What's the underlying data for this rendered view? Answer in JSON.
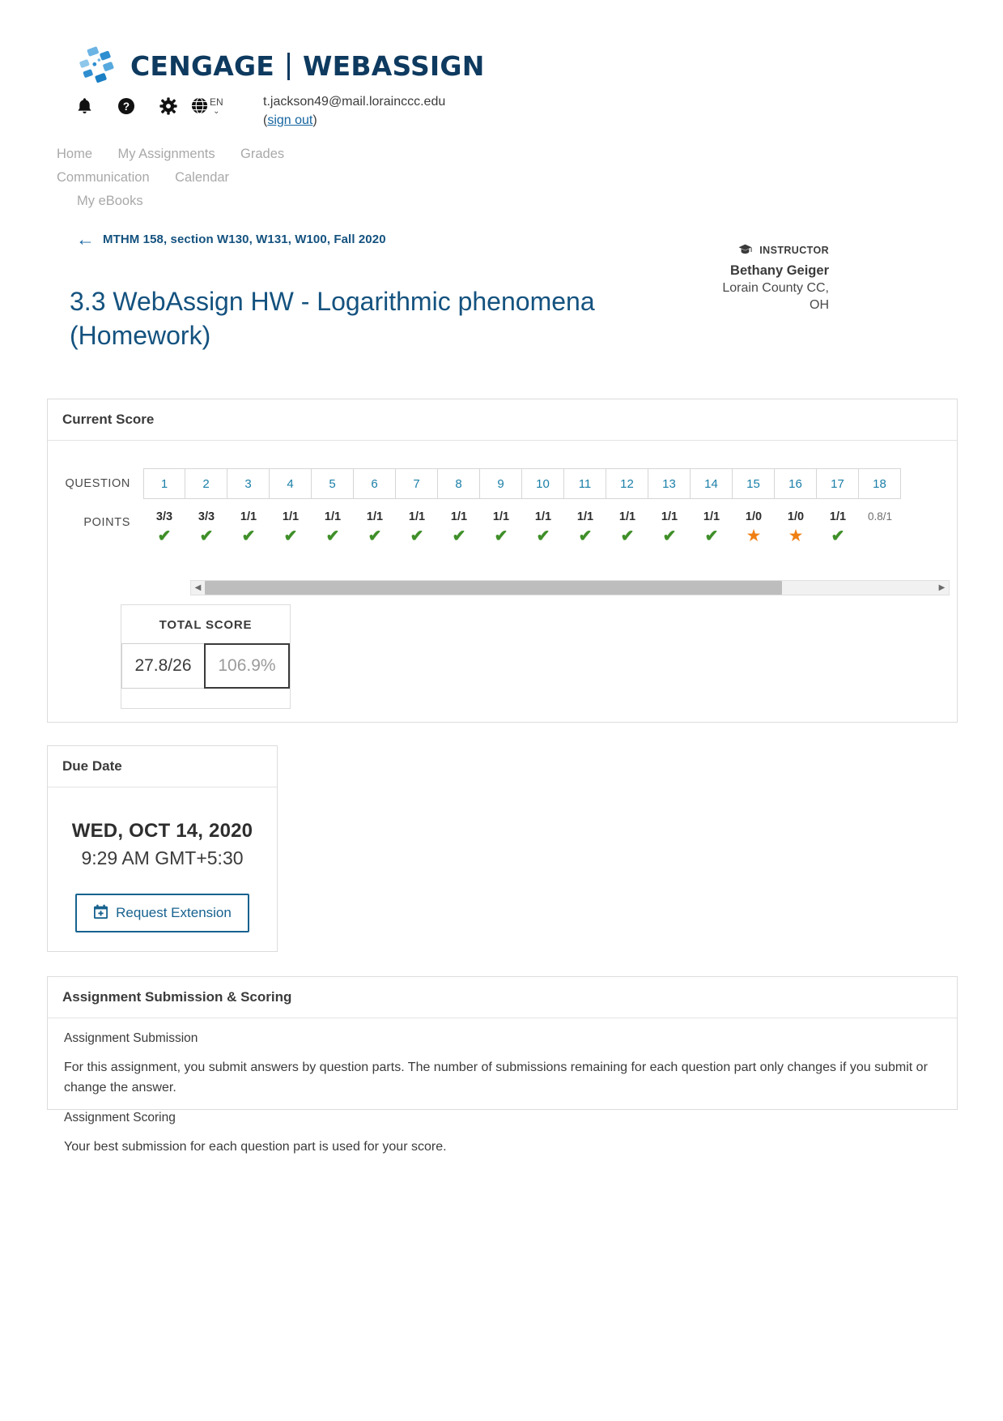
{
  "brand": {
    "primary": "CENGAGE",
    "secondary": "WEBASSIGN",
    "color": "#0e3a5f"
  },
  "utility": {
    "icons": [
      {
        "name": "notifications-icon",
        "glyph": "🔔"
      },
      {
        "name": "help-icon",
        "glyph": "?"
      },
      {
        "name": "settings-icon",
        "glyph": "⚙"
      },
      {
        "name": "language-globe-icon",
        "glyph": "🌐"
      }
    ],
    "language_code": "EN",
    "caret": "⌄"
  },
  "account": {
    "email": "t.jackson49@mail.lorainccc.edu",
    "signout_open": "(",
    "signout_label": "sign out",
    "signout_close": ")"
  },
  "nav": {
    "row1": [
      "Home",
      "My Assignments",
      "Grades"
    ],
    "row2": [
      "Communication",
      "Calendar"
    ],
    "row3": [
      "My eBooks"
    ]
  },
  "breadcrumb": {
    "arrow": "←",
    "label": "MTHM 158, section W130, W131, W100, Fall 2020"
  },
  "title": "3.3 WebAssign HW - Logarithmic phenomena (Homework)",
  "instructor": {
    "cap_icon": "🎓",
    "heading": "INSTRUCTOR",
    "name": "Bethany Geiger",
    "school_line1": "Lorain County CC,",
    "school_line2": "OH"
  },
  "current_score": {
    "card_title": "Current Score",
    "question_label": "QUESTION",
    "points_label": "POINTS",
    "questions": [
      {
        "number": "1",
        "points": "3/3",
        "status": "check"
      },
      {
        "number": "2",
        "points": "3/3",
        "status": "check"
      },
      {
        "number": "3",
        "points": "1/1",
        "status": "check"
      },
      {
        "number": "4",
        "points": "1/1",
        "status": "check"
      },
      {
        "number": "5",
        "points": "1/1",
        "status": "check"
      },
      {
        "number": "6",
        "points": "1/1",
        "status": "check"
      },
      {
        "number": "7",
        "points": "1/1",
        "status": "check"
      },
      {
        "number": "8",
        "points": "1/1",
        "status": "check"
      },
      {
        "number": "9",
        "points": "1/1",
        "status": "check"
      },
      {
        "number": "10",
        "points": "1/1",
        "status": "check"
      },
      {
        "number": "11",
        "points": "1/1",
        "status": "check"
      },
      {
        "number": "12",
        "points": "1/1",
        "status": "check"
      },
      {
        "number": "13",
        "points": "1/1",
        "status": "check"
      },
      {
        "number": "14",
        "points": "1/1",
        "status": "check"
      },
      {
        "number": "15",
        "points": "1/0",
        "status": "star"
      },
      {
        "number": "16",
        "points": "1/0",
        "status": "star"
      },
      {
        "number": "17",
        "points": "1/1",
        "status": "check"
      },
      {
        "number": "18",
        "points": "0.8/1",
        "status": "none"
      }
    ],
    "marks": {
      "check": "✔",
      "star": "★",
      "none": ""
    },
    "colors": {
      "check": "#3f8f29",
      "star": "#f07f13",
      "question_number": "#1a7fa8"
    },
    "scrollbar": {
      "left_arrow": "◀",
      "right_arrow": "▶",
      "thumb_percent": "79%"
    },
    "total": {
      "label": "TOTAL SCORE",
      "points": "27.8/26",
      "percent": "106.9%"
    }
  },
  "due_date": {
    "card_title": "Due Date",
    "date": "WED, OCT 14, 2020",
    "time": "9:29 AM GMT+5:30",
    "button_label": "Request Extension",
    "button_icon": "📅"
  },
  "submission": {
    "card_title": "Assignment Submission & Scoring",
    "section1_heading": "Assignment Submission",
    "section1_text": "For this assignment, you submit answers by question parts. The number of submissions remaining for each question part only changes if you submit or change the answer.",
    "section2_heading": "Assignment Scoring",
    "section2_text": "Your best submission for each question part is used for your score."
  }
}
